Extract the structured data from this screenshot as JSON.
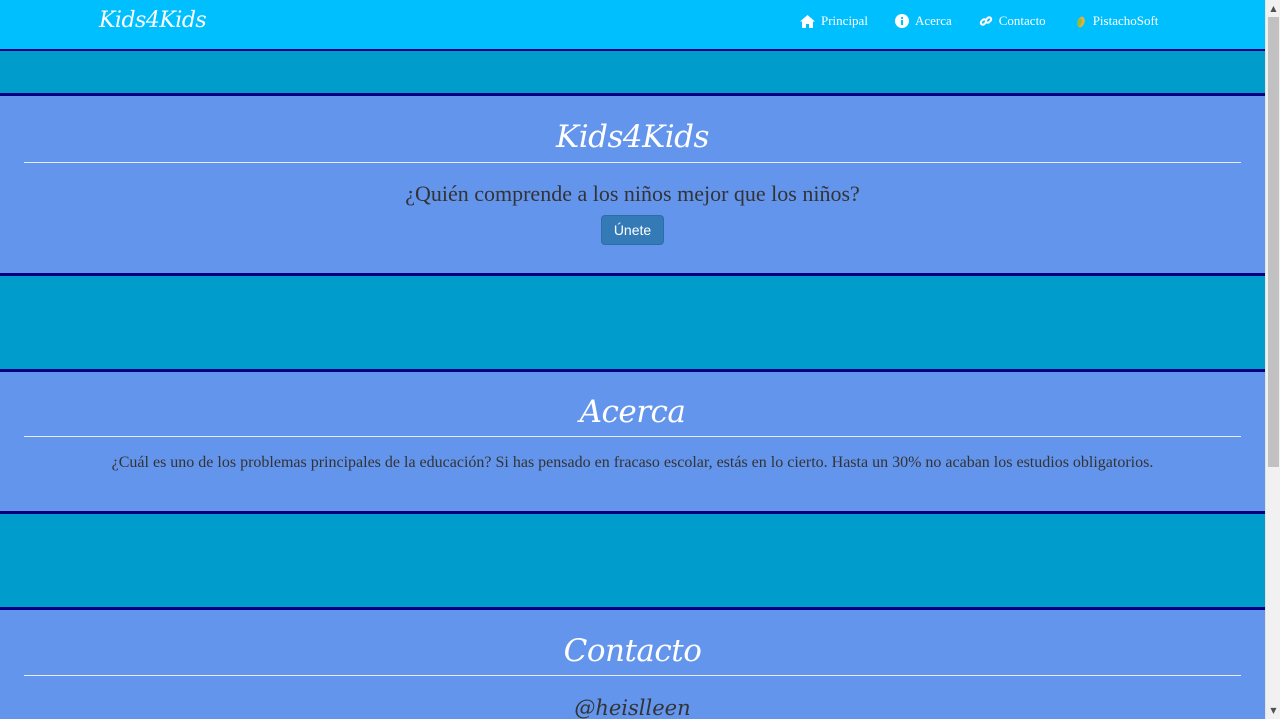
{
  "navbar": {
    "brand": "Kids4Kids",
    "links": [
      {
        "label": "Principal",
        "icon": "home-icon"
      },
      {
        "label": "Acerca",
        "icon": "info-icon"
      },
      {
        "label": "Contacto",
        "icon": "link-icon"
      },
      {
        "label": "PistachoSoft",
        "icon": "pistachio-icon"
      }
    ]
  },
  "hero": {
    "title": "Kids4Kids",
    "tagline": "¿Quién comprende a los niños mejor que los niños?",
    "join_label": "Únete"
  },
  "about": {
    "title": "Acerca",
    "text": "¿Cuál es uno de los problemas principales de la educación? Si has pensado en fracaso escolar, estás en lo cierto. Hasta un 30% no acaban los estudios obligatorios."
  },
  "contact": {
    "title": "Contacto",
    "handle": "@heislleen"
  },
  "colors": {
    "navbar": "#00bfff",
    "band": "#009ccc",
    "section": "#6495ed",
    "border": "#000080",
    "button": "#337ab7"
  }
}
